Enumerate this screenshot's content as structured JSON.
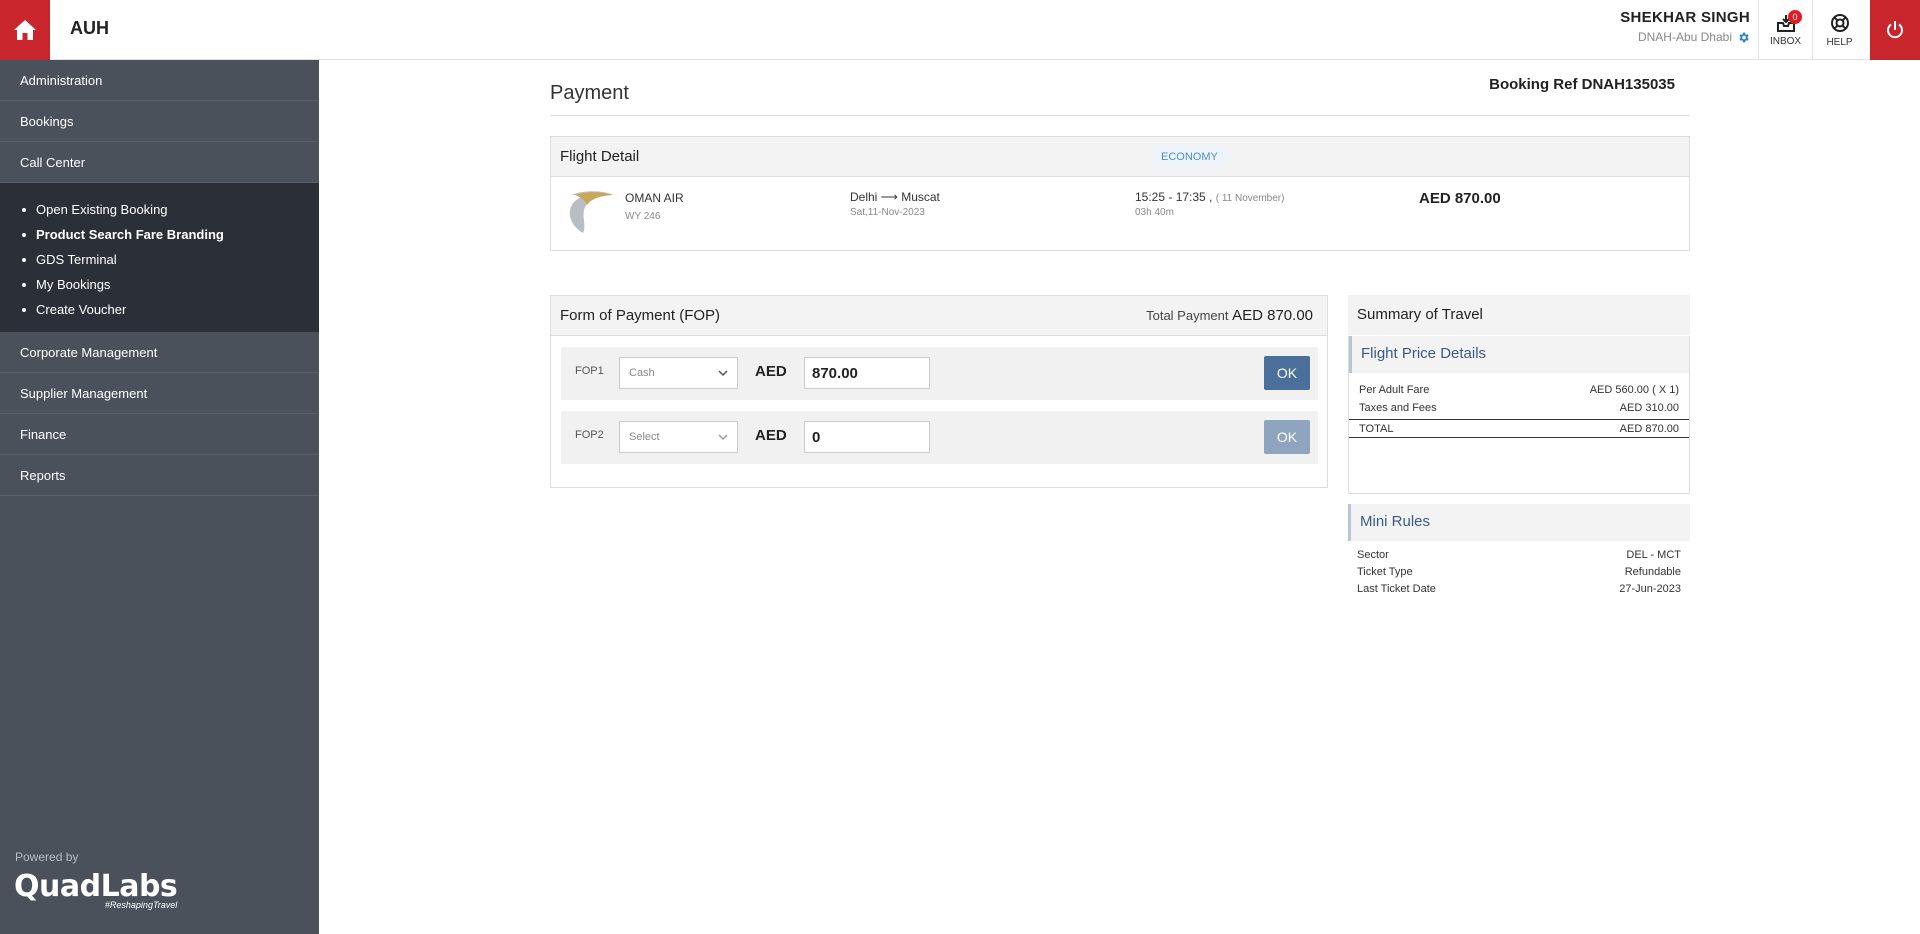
{
  "header": {
    "brand": "AUH",
    "user_name": "SHEKHAR SINGH",
    "user_branch": "DNAH-Abu Dhabi",
    "inbox_label": "INBOX",
    "inbox_count": "0",
    "help_label": "HELP",
    "accent_color": "#c9252c"
  },
  "sidebar": {
    "items_top": [
      {
        "label": "Administration"
      },
      {
        "label": "Bookings"
      },
      {
        "label": "Call Center"
      }
    ],
    "sub_items": [
      {
        "label": "Open Existing Booking"
      },
      {
        "label": "Product Search Fare Branding"
      },
      {
        "label": "GDS Terminal"
      },
      {
        "label": "My Bookings"
      },
      {
        "label": "Create Voucher"
      }
    ],
    "items_bottom": [
      {
        "label": "Corporate Management"
      },
      {
        "label": "Supplier Management"
      },
      {
        "label": "Finance"
      },
      {
        "label": "Reports"
      }
    ],
    "powered_by": "Powered by",
    "logo_text": "QuadLabs",
    "logo_tagline": "#ReshapingTravel"
  },
  "page": {
    "title": "Payment",
    "booking_ref": "Booking Ref DNAH135035"
  },
  "flight_detail": {
    "title": "Flight Detail",
    "cabin": "ECONOMY",
    "airline": "OMAN AIR",
    "flight_no": "WY 246",
    "route": "Delhi ⟶ Muscat",
    "date": "Sat,11-Nov-2023",
    "times": "15:25 - 17:35 , ",
    "date_note": "( 11 November)",
    "duration": "03h 40m",
    "price": "AED 870.00"
  },
  "fop": {
    "title": "Form of Payment (FOP)",
    "total_label": "Total Payment",
    "total_value": "AED 870.00",
    "rows": [
      {
        "label": "FOP1",
        "select": "Cash",
        "currency": "AED",
        "amount": "870.00",
        "button": "OK"
      },
      {
        "label": "FOP2",
        "select": "Select",
        "currency": "AED",
        "amount": "0",
        "button": "OK"
      }
    ]
  },
  "summary": {
    "title": "Summary of Travel",
    "price_title": "Flight Price Details",
    "per_adult_label": "Per Adult Fare",
    "per_adult_value": "AED 560.00 ( X 1)",
    "taxes_label": "Taxes and Fees",
    "taxes_value": "AED 310.00",
    "total_label": "TOTAL",
    "total_value": "AED 870.00",
    "mini_title": "Mini Rules",
    "rules": [
      {
        "label": "Sector",
        "value": "DEL - MCT"
      },
      {
        "label": "Ticket Type",
        "value": "Refundable"
      },
      {
        "label": "Last Ticket Date",
        "value": "27-Jun-2023"
      }
    ]
  }
}
